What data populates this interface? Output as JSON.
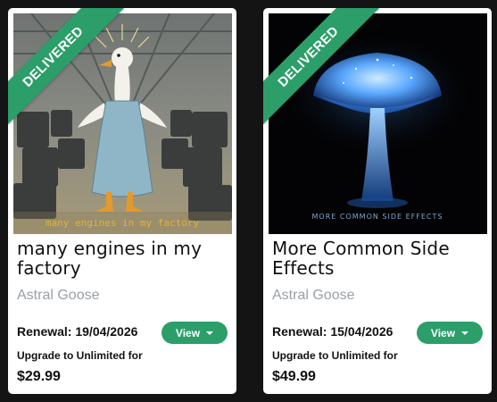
{
  "cards": [
    {
      "ribbon": "DELIVERED",
      "title": "many engines in my factory",
      "artist": "Astral Goose",
      "renewal": "Renewal: 19/04/2026",
      "view_label": "View",
      "upgrade_label": "Upgrade to Unlimited for",
      "price": "$29.99",
      "art_caption": "many engines in my factory",
      "art_icon": "goose-factory-artwork"
    },
    {
      "ribbon": "DELIVERED",
      "title": "More Common Side Effects",
      "artist": "Astral Goose",
      "renewal": "Renewal: 15/04/2026",
      "view_label": "View",
      "upgrade_label": "Upgrade to Unlimited for",
      "price": "$49.99",
      "art_caption": "MORE COMMON SIDE EFFECTS",
      "art_icon": "glowing-mushroom-artwork"
    }
  ],
  "colors": {
    "background": "#141414",
    "card": "#ffffff",
    "accent": "#2b9e6a",
    "artist_text": "#9aa0a6"
  }
}
